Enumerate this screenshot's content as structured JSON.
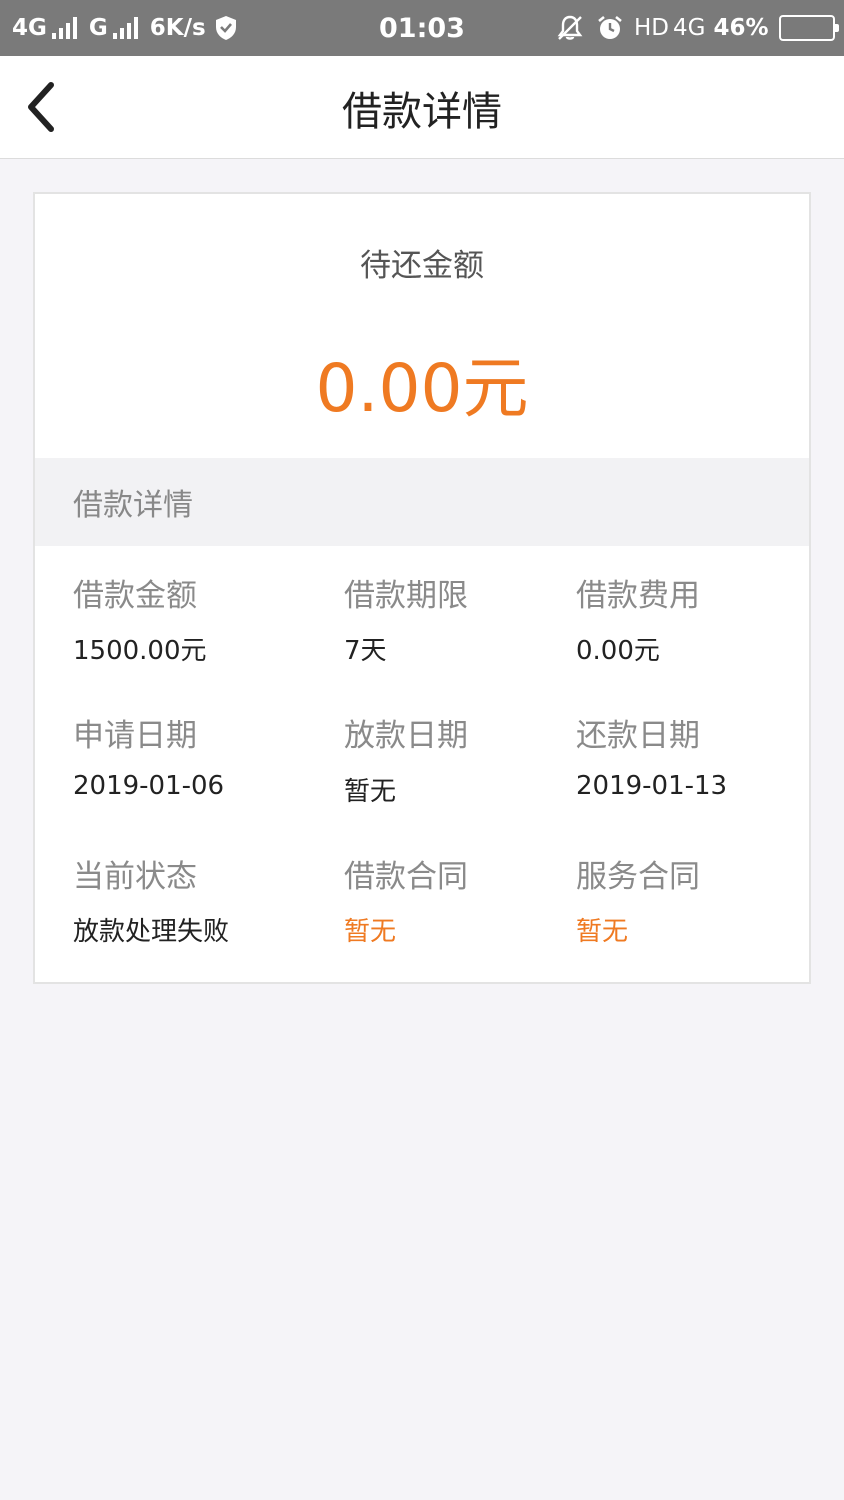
{
  "status_bar": {
    "net1": "4G",
    "net2": "G",
    "speed": "6K/s",
    "time": "01:03",
    "hd": "HD",
    "net3": "4G",
    "battery": "46%"
  },
  "navbar": {
    "title": "借款详情"
  },
  "summary": {
    "label": "待还金额",
    "amount": "0.00元"
  },
  "details": {
    "section_title": "借款详情",
    "fields": [
      {
        "label": "借款金额",
        "value": "1500.00元"
      },
      {
        "label": "借款期限",
        "value": "7天"
      },
      {
        "label": "借款费用",
        "value": "0.00元"
      },
      {
        "label": "申请日期",
        "value": "2019-01-06"
      },
      {
        "label": "放款日期",
        "value": "暂无"
      },
      {
        "label": "还款日期",
        "value": "2019-01-13"
      },
      {
        "label": "当前状态",
        "value": "放款处理失败"
      },
      {
        "label": "借款合同",
        "value": "暂无"
      },
      {
        "label": "服务合同",
        "value": "暂无"
      }
    ]
  },
  "colors": {
    "accent": "#ef7a22",
    "status_bar": "#7a7a7a",
    "background": "#f5f4f8"
  }
}
